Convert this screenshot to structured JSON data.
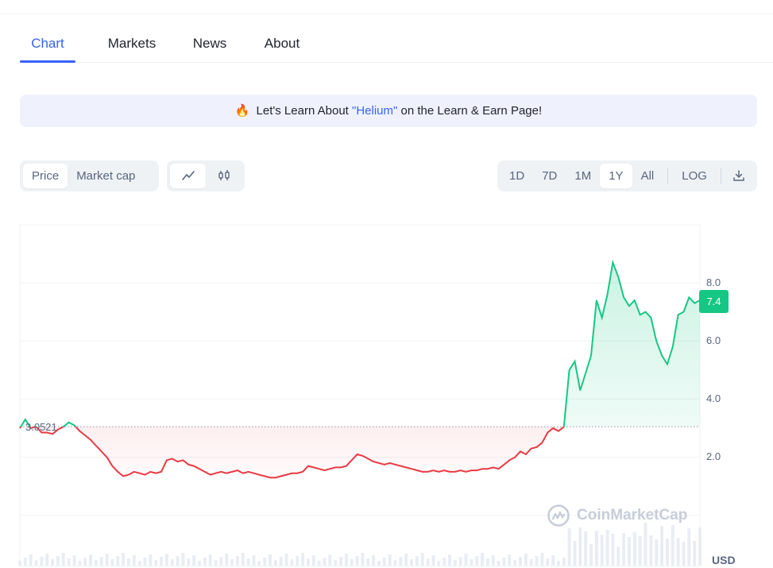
{
  "tabs": [
    {
      "label": "Chart",
      "active": true
    },
    {
      "label": "Markets",
      "active": false
    },
    {
      "label": "News",
      "active": false
    },
    {
      "label": "About",
      "active": false
    }
  ],
  "banner": {
    "icon": "fire-icon",
    "prefix": "Let's Learn About ",
    "link": "\"Helium\"",
    "suffix": " on the Learn & Earn Page!"
  },
  "metric_toggle": [
    {
      "label": "Price",
      "selected": true
    },
    {
      "label": "Market cap",
      "selected": false
    }
  ],
  "chart_type_toggle": [
    {
      "icon": "line-chart-icon",
      "selected": true
    },
    {
      "icon": "candlestick-icon",
      "selected": false
    }
  ],
  "range_toggle": [
    {
      "label": "1D",
      "selected": false
    },
    {
      "label": "7D",
      "selected": false
    },
    {
      "label": "1M",
      "selected": false
    },
    {
      "label": "1Y",
      "selected": true
    },
    {
      "label": "All",
      "selected": false
    }
  ],
  "log_label": "LOG",
  "download_icon": "download-icon",
  "colors": {
    "accent": "#3861fb",
    "up": "#16c784",
    "down": "#ea3943"
  },
  "chart_data": {
    "type": "line",
    "ylim": [
      -1.5,
      10
    ],
    "yticks": [
      "2.0",
      "4.0",
      "6.0",
      "8.0"
    ],
    "ytick_values": [
      2,
      4,
      6,
      8
    ],
    "baseline_value": 3.0521,
    "baseline_label": "3.0521",
    "current_price_label": "7.4",
    "currency_label": "USD",
    "watermark": "CoinMarketCap",
    "series": [
      {
        "values": [
          3.0,
          3.3,
          3.0,
          3.05,
          2.85,
          2.85,
          2.8,
          2.95,
          3.05,
          3.2,
          3.1,
          2.9,
          2.75,
          2.6,
          2.4,
          2.2,
          2.0,
          1.7,
          1.5,
          1.35,
          1.4,
          1.5,
          1.45,
          1.4,
          1.5,
          1.45,
          1.5,
          1.9,
          1.95,
          1.85,
          1.9,
          1.75,
          1.7,
          1.6,
          1.5,
          1.4,
          1.45,
          1.5,
          1.45,
          1.5,
          1.55,
          1.45,
          1.5,
          1.45,
          1.4,
          1.35,
          1.3,
          1.3,
          1.35,
          1.4,
          1.45,
          1.45,
          1.5,
          1.7,
          1.65,
          1.6,
          1.55,
          1.6,
          1.65,
          1.65,
          1.7,
          1.9,
          2.1,
          2.05,
          1.95,
          1.85,
          1.8,
          1.75,
          1.8,
          1.75,
          1.7,
          1.65,
          1.6,
          1.55,
          1.5,
          1.5,
          1.55,
          1.5,
          1.55,
          1.5,
          1.5,
          1.55,
          1.5,
          1.55,
          1.55,
          1.6,
          1.6,
          1.65,
          1.6,
          1.75,
          1.9,
          2.0,
          2.2,
          2.1,
          2.3,
          2.35,
          2.5,
          2.85,
          3.0,
          2.9,
          3.05,
          5.0,
          5.3,
          4.3,
          4.9,
          5.5,
          7.4,
          6.8,
          7.6,
          8.7,
          8.2,
          7.5,
          7.2,
          7.4,
          6.9,
          7.0,
          6.8,
          6.0,
          5.5,
          5.2,
          5.8,
          6.9,
          7.0,
          7.5,
          7.3,
          7.4
        ]
      }
    ]
  }
}
